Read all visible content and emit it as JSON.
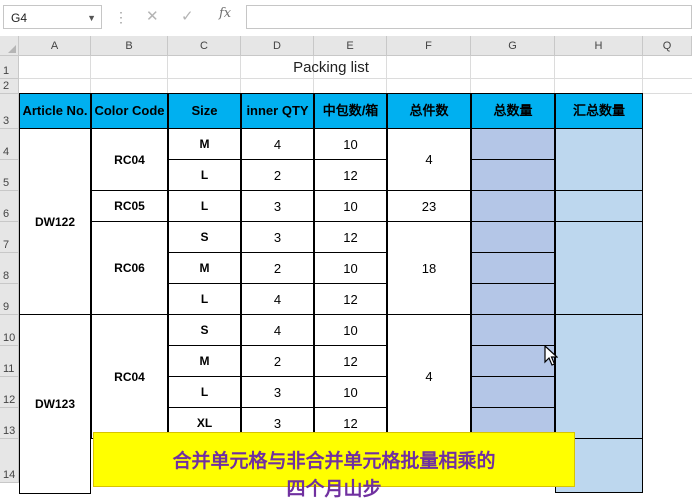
{
  "formula_bar": {
    "name_box": "G4",
    "cancel_icon": "close-icon",
    "enter_icon": "check-icon",
    "fx_label": "fx",
    "formula": ""
  },
  "columns": [
    "A",
    "B",
    "C",
    "D",
    "E",
    "F",
    "G",
    "H",
    "Q"
  ],
  "rows": [
    "1",
    "2",
    "3",
    "4",
    "5",
    "6",
    "7",
    "8",
    "9",
    "10",
    "11",
    "12",
    "13",
    "14"
  ],
  "sheet_title": "Packing list",
  "headers": {
    "article": "Article No.",
    "color": "Color Code",
    "size": "Size",
    "inner": "inner QTY",
    "per_box": "中包数/箱",
    "total_pieces": "总件数",
    "total_qty": "总数量",
    "summary_qty": "汇总数量"
  },
  "articles": [
    "DW122",
    "DW123"
  ],
  "color_codes": [
    "RC04",
    "RC05",
    "RC06",
    "RC04"
  ],
  "data_rows": [
    {
      "size": "M",
      "inner": "4",
      "per_box": "10"
    },
    {
      "size": "L",
      "inner": "2",
      "per_box": "12"
    },
    {
      "size": "L",
      "inner": "3",
      "per_box": "10"
    },
    {
      "size": "S",
      "inner": "3",
      "per_box": "12"
    },
    {
      "size": "M",
      "inner": "2",
      "per_box": "10"
    },
    {
      "size": "L",
      "inner": "4",
      "per_box": "12"
    },
    {
      "size": "S",
      "inner": "4",
      "per_box": "10"
    },
    {
      "size": "M",
      "inner": "2",
      "per_box": "12"
    },
    {
      "size": "L",
      "inner": "3",
      "per_box": "10"
    },
    {
      "size": "XL",
      "inner": "3",
      "per_box": "12"
    }
  ],
  "total_pieces": [
    "4",
    "23",
    "18",
    "4"
  ],
  "banner_text": "合并单元格与非合并单元格批量相乘的",
  "banner_text_2": "四个月山步",
  "colors": {
    "header_fill": "#00b0f0",
    "g_fill": "#b4c6e7",
    "h_fill": "#bdd7ee",
    "banner_fill": "#ffff00",
    "banner_text": "#7030a0"
  }
}
